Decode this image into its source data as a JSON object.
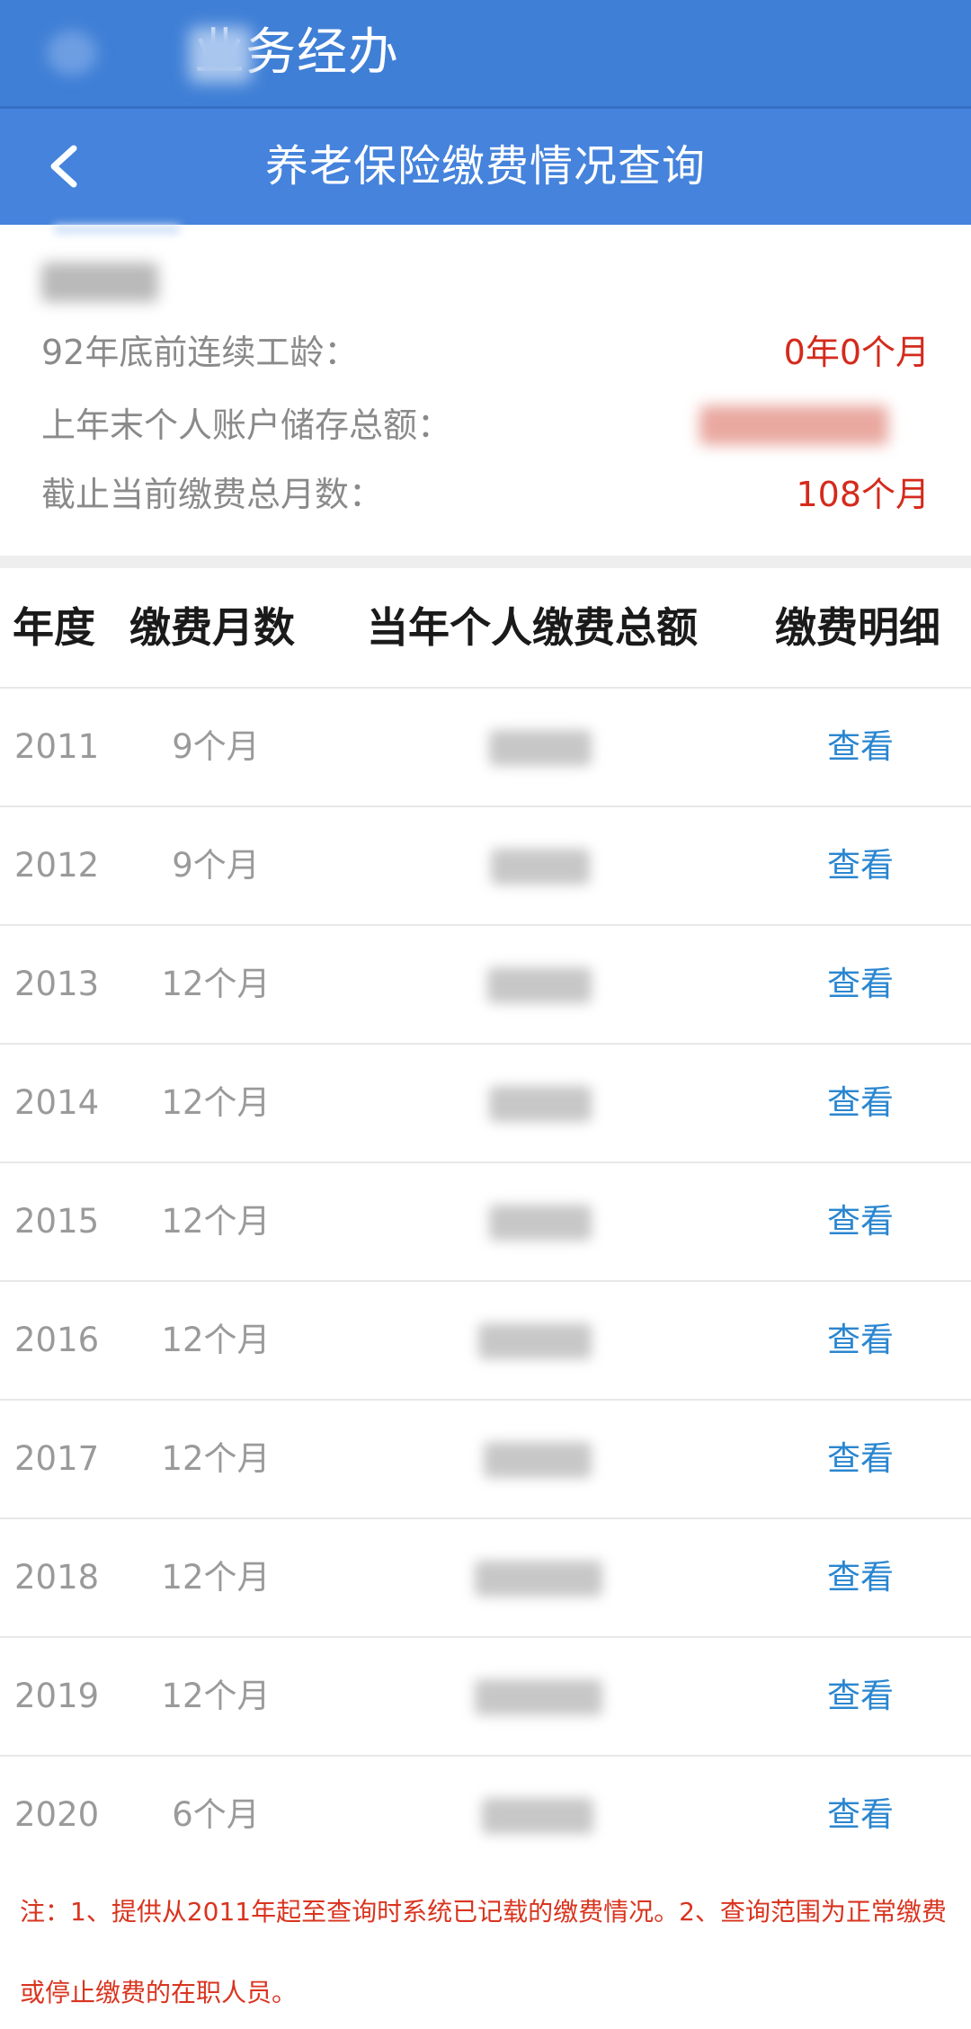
{
  "top_bar": {
    "title": "业务经办"
  },
  "nav": {
    "back_icon": "chevron-left-icon",
    "title": "养老保险缴费情况查询"
  },
  "summary": {
    "rows": [
      {
        "label": "92年底前连续工龄：",
        "value": "0年0个月"
      },
      {
        "label": "上年末个人账户储存总额：",
        "value": ""
      },
      {
        "label": "截止当前缴费总月数：",
        "value": "108个月"
      }
    ]
  },
  "table": {
    "headers": {
      "year": "年度",
      "months": "缴费月数",
      "total": "当年个人缴费总额",
      "detail": "缴费明细"
    },
    "rows": [
      {
        "year": "2011",
        "months": "9个月",
        "detail": "查看"
      },
      {
        "year": "2012",
        "months": "9个月",
        "detail": "查看"
      },
      {
        "year": "2013",
        "months": "12个月",
        "detail": "查看"
      },
      {
        "year": "2014",
        "months": "12个月",
        "detail": "查看"
      },
      {
        "year": "2015",
        "months": "12个月",
        "detail": "查看"
      },
      {
        "year": "2016",
        "months": "12个月",
        "detail": "查看"
      },
      {
        "year": "2017",
        "months": "12个月",
        "detail": "查看"
      },
      {
        "year": "2018",
        "months": "12个月",
        "detail": "查看"
      },
      {
        "year": "2019",
        "months": "12个月",
        "detail": "查看"
      },
      {
        "year": "2020",
        "months": "6个月",
        "detail": "查看"
      }
    ]
  },
  "note": "注：1、提供从2011年起至查询时系统已记载的缴费情况。2、查询范围为正常缴费或停止缴费的在职人员。",
  "colors": {
    "header_blue": "#4583dc",
    "value_red": "#d42a1c",
    "link_blue": "#2a86d0",
    "note_red": "#d9341f"
  }
}
